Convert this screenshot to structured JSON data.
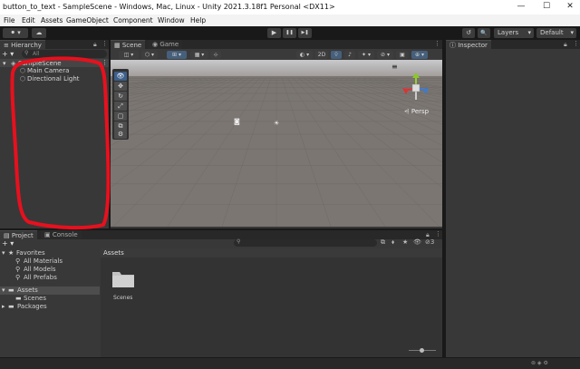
{
  "window": {
    "title": "button_to_text - SampleScene - Windows, Mac, Linux - Unity 2021.3.18f1 Personal <DX11>",
    "minimize": "—",
    "maximize": "☐",
    "close": "✕"
  },
  "menu": [
    "File",
    "Edit",
    "Assets",
    "GameObject",
    "Component",
    "Window",
    "Help"
  ],
  "toolbar": {
    "account": "⚫ ▾",
    "cloud": "☁",
    "play": "▶",
    "pause": "❚❚",
    "step": "▶❚",
    "history": "↺",
    "search": "🔍",
    "layers": "Layers",
    "layout": "Default"
  },
  "hierarchy": {
    "tab": "Hierarchy",
    "search_placeholder": "All",
    "add": "+ ▾",
    "scene": "SampleScene",
    "items": [
      "Main Camera",
      "Directional Light"
    ]
  },
  "scene": {
    "tab_scene": "Scene",
    "tab_game": "Game",
    "btn_2d": "2D",
    "persp_label": "Persp"
  },
  "inspector": {
    "tab": "Inspector"
  },
  "project": {
    "tab_project": "Project",
    "tab_console": "Console",
    "add": "+ ▾",
    "favorites": "Favorites",
    "favorites_items": [
      "All Materials",
      "All Models",
      "All Prefabs"
    ],
    "assets": "Assets",
    "assets_children": [
      "Scenes"
    ],
    "packages": "Packages",
    "breadcrumb": "Assets",
    "folder_label": "Scenes",
    "hidden_count": "3"
  },
  "colors": {
    "highlight_red": "#e8101e",
    "selected_tool": "#3d5f8a"
  }
}
